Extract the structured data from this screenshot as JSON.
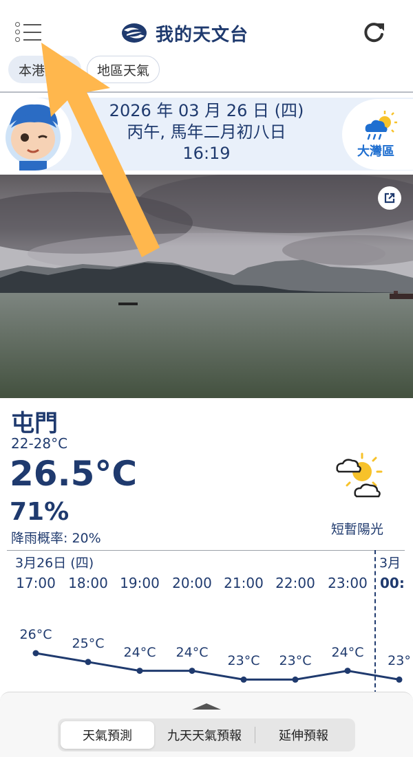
{
  "header": {
    "title": "我的天文台"
  },
  "tabs": [
    {
      "label": "本港天氣",
      "active": true
    },
    {
      "label": "地區天氣",
      "active": false
    }
  ],
  "date_banner": {
    "date": "2026 年 03 月 26 日 (四)",
    "lunar": "丙午, 馬年二月初八日",
    "time": "16:19",
    "gba_label": "大灣區"
  },
  "current": {
    "station": "屯門",
    "temp_range": "22-28°C",
    "temperature": "26.5°C",
    "humidity": "71%",
    "rain_probability": "降雨概率: 20%",
    "weather_desc": "短暫陽光",
    "weather_icon": "sunny-periods-icon"
  },
  "hourly": {
    "day_label": "3月26日 (四)",
    "next_day_label": "3月",
    "hours": [
      "17:00",
      "18:00",
      "19:00",
      "20:00",
      "21:00",
      "22:00",
      "23:00",
      "00:"
    ],
    "temps": [
      "26°C",
      "25°C",
      "24°C",
      "24°C",
      "23°C",
      "23°C",
      "24°C",
      "23°"
    ],
    "temp_values": [
      26,
      25,
      24,
      24,
      23,
      23,
      24,
      23
    ]
  },
  "bottom_nav": [
    {
      "label": "天氣預測",
      "active": true
    },
    {
      "label": "九天天氣預報",
      "active": false
    },
    {
      "label": "延伸預報",
      "active": false
    }
  ],
  "colors": {
    "primary": "#1f3a6e",
    "accent_blue": "#1f6fd0",
    "arrow": "#ffb74d"
  }
}
